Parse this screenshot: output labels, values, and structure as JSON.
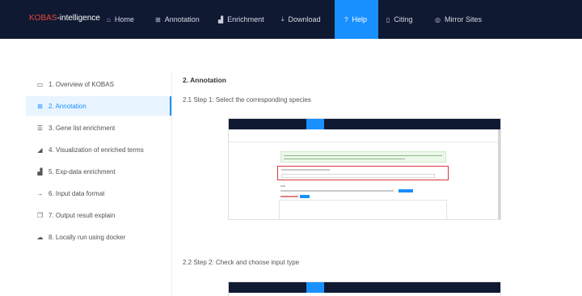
{
  "header": {
    "logo_brand": "KOBAS",
    "logo_rest": "-intelligence",
    "nav": [
      {
        "label": "Home",
        "icon": "home-icon"
      },
      {
        "label": "Annotation",
        "icon": "grid-icon"
      },
      {
        "label": "Enrichment",
        "icon": "bar-chart-icon"
      },
      {
        "label": "Download",
        "icon": "download-icon"
      },
      {
        "label": "Help",
        "icon": "question-icon",
        "active": true
      },
      {
        "label": "Citing",
        "icon": "document-icon"
      },
      {
        "label": "Mirror Sites",
        "icon": "globe-icon"
      }
    ]
  },
  "sidebar": {
    "items": [
      {
        "label": "1. Overview of KOBAS",
        "icon": "laptop-icon"
      },
      {
        "label": "2. Annotation",
        "icon": "grid-icon",
        "active": true
      },
      {
        "label": "3. Gene list enrichment",
        "icon": "list-icon"
      },
      {
        "label": "4. Visualization of enriched terms",
        "icon": "area-chart-icon"
      },
      {
        "label": "5. Exp-data enrichment",
        "icon": "bar-chart-icon"
      },
      {
        "label": "6. Input data format",
        "icon": "arrow-right-icon"
      },
      {
        "label": "7. Output result explain",
        "icon": "copy-icon"
      },
      {
        "label": "8. Locally run using docker",
        "icon": "cloud-icon"
      }
    ]
  },
  "content": {
    "section_title": "2. Annotation",
    "step1": "2.1 Step 1: Select the corresponding species",
    "step2": "2.2 Step 2: Check and choose input type"
  },
  "colors": {
    "nav_bg": "#0f1932",
    "accent": "#1890ff",
    "brand_red": "#e8473c",
    "highlight_red": "#d9363e"
  }
}
